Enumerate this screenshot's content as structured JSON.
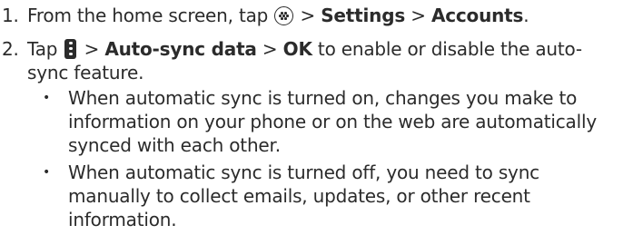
{
  "steps": [
    {
      "number": "1.",
      "text_from": "From the home screen, tap",
      "apps_icon": "apps-grid-icon",
      "sep1": ">",
      "settings": "Settings",
      "sep2": ">",
      "accounts": "Accounts",
      "end": "."
    },
    {
      "number": "2.",
      "tap": "Tap",
      "menu_icon": "more-options-icon",
      "sep1": ">",
      "auto_sync": "Auto-sync data",
      "sep2": ">",
      "ok": "OK",
      "rest_line1": "to enable or disable the auto-",
      "rest_line2": "sync feature."
    }
  ],
  "bullets": [
    {
      "symbol": "•",
      "lines": [
        "When automatic sync is turned on, changes you make to",
        "information on your phone or on the web are automatically",
        "synced with each other."
      ]
    },
    {
      "symbol": "•",
      "lines": [
        "When automatic sync is turned off, you need to sync",
        "manually to collect emails, updates, or other recent",
        "information."
      ]
    }
  ]
}
